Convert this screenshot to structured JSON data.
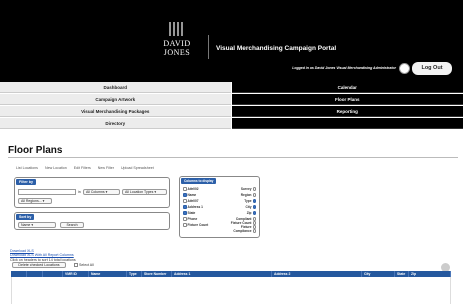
{
  "header": {
    "logo_line1": "DAVID",
    "logo_line2": "JONES",
    "portal_title": "Visual Merchandising Campaign Portal",
    "logged_in_text": "Logged in as David Jones Visual Merchandising Administrator",
    "logout_label": "Log Out"
  },
  "nav": {
    "rows": [
      {
        "left": "Dashboard",
        "right": "Calendar"
      },
      {
        "left": "Campaign Artwork",
        "right": "Floor Plans"
      },
      {
        "left": "Visual Merchandising Packages",
        "right": "Reporting"
      },
      {
        "left": "Directory",
        "right": ""
      }
    ],
    "active": "Floor Plans"
  },
  "page": {
    "title": "Floor Plans"
  },
  "subnav": [
    "List Locations",
    "New Location",
    "Edit Filters",
    "New Filter",
    "Upload Spreadsheet"
  ],
  "filter": {
    "tag": "Filter by",
    "search_value": "",
    "in_label": "in",
    "columns_select": "All Columns",
    "types_select": "All Location Types",
    "regions_select": "All Regions..."
  },
  "sort": {
    "tag": "Sort by",
    "field_select": "Name",
    "search_button": "Search"
  },
  "columns_panel": {
    "tag": "Columns to display",
    "left": [
      {
        "label": "Attr002",
        "checked": false
      },
      {
        "label": "Name",
        "checked": true
      },
      {
        "label": "Attr007",
        "checked": false
      },
      {
        "label": "Address 1",
        "checked": true
      },
      {
        "label": "State",
        "checked": true
      },
      {
        "label": "Phone",
        "checked": false
      },
      {
        "label": "Fixture Count",
        "checked": false
      }
    ],
    "right": [
      {
        "label": "Survey",
        "checked": false
      },
      {
        "label": "Region",
        "checked": false
      },
      {
        "label": "Type",
        "checked": true
      },
      {
        "label": "City",
        "checked": true
      },
      {
        "label": "Zip",
        "checked": true
      },
      {
        "label": "Compliant",
        "checked": false
      },
      {
        "label": "Fixture Count",
        "checked": false
      },
      {
        "label": "Fixture",
        "checked": false
      },
      {
        "label": "Compliance",
        "checked": false
      }
    ]
  },
  "downloads": {
    "xls": "Download XLS",
    "xls_all": "Download XLS With All Report Columns",
    "sort_hint": "Click on headers to sort 14 total locations",
    "delete_button": "Delete checked Locations",
    "select_all": "Select All"
  },
  "table": {
    "columns": [
      "",
      "",
      "",
      "VMR ID",
      "Name",
      "Type",
      "Store Number",
      "Address 1",
      "Address 2",
      "City",
      "State",
      "Zip"
    ]
  }
}
